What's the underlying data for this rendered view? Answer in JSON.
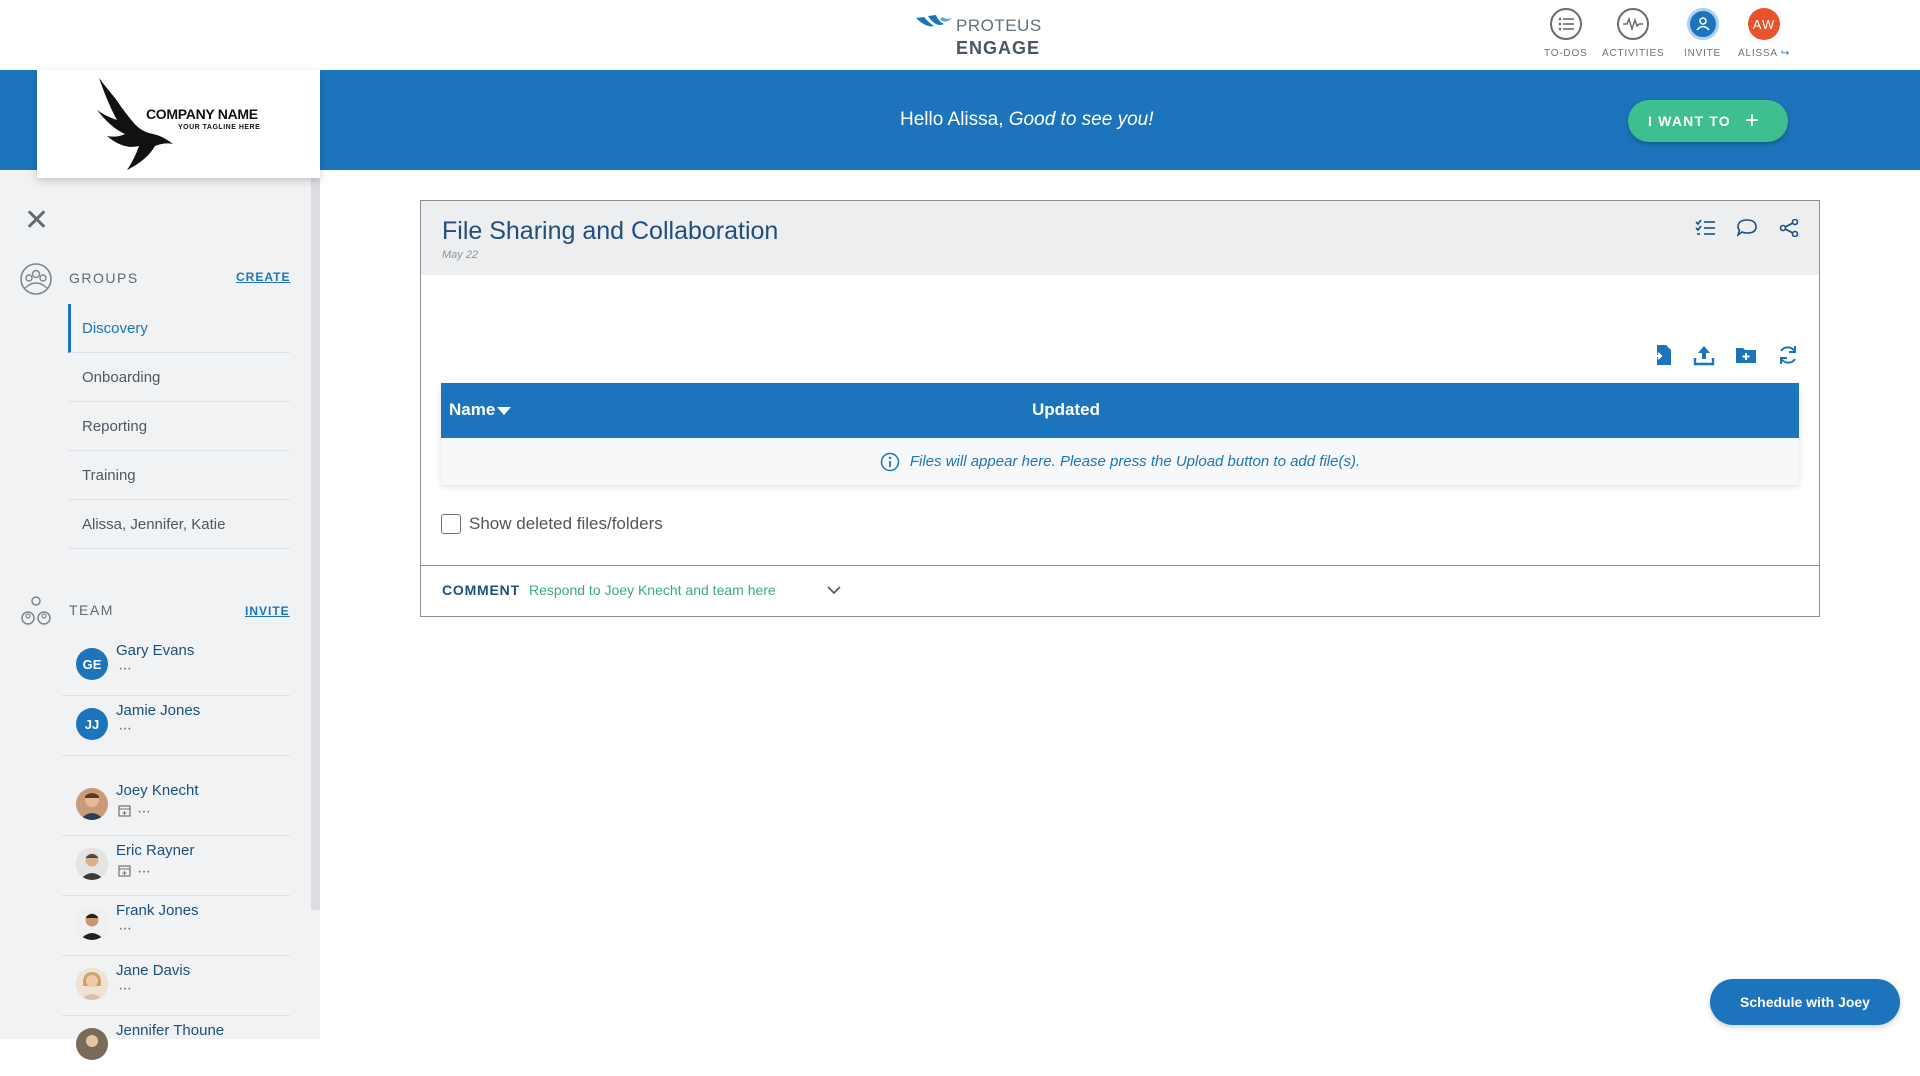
{
  "brand": {
    "line1": "PROTEUS",
    "line2": "ENGAGE"
  },
  "topnav": {
    "todos": "TO-DOS",
    "activities": "ACTIVITIES",
    "invite": "INVITE",
    "user_initials": "AW",
    "user_label": "ALISSA"
  },
  "company": {
    "name": "COMPANY NAME",
    "tagline": "YOUR TAGLINE HERE"
  },
  "banner": {
    "hello": "Hello Alissa,",
    "tagline": "Good to see you!",
    "cta": "I WANT TO"
  },
  "sidebar": {
    "groups_title": "GROUPS",
    "groups_action": "CREATE",
    "groups": [
      "Discovery",
      "Onboarding",
      "Reporting",
      "Training",
      "Alissa, Jennifer, Katie"
    ],
    "team_title": "TEAM",
    "team_action": "INVITE",
    "members": [
      {
        "name": "Gary Evans",
        "initials": "GE"
      },
      {
        "name": "Jamie Jones",
        "initials": "JJ"
      },
      {
        "name": "Joey Knecht"
      },
      {
        "name": "Eric Rayner"
      },
      {
        "name": "Frank Jones"
      },
      {
        "name": "Jane Davis"
      },
      {
        "name": "Jennifer Thoune"
      }
    ]
  },
  "card": {
    "title": "File Sharing and Collaboration",
    "date": "May 22",
    "col_name": "Name",
    "col_updated": "Updated",
    "empty_msg": "Files will appear here. Please press the Upload button to add file(s).",
    "show_deleted": "Show deleted files/folders",
    "comment_label": "COMMENT",
    "comment_prompt": "Respond to Joey Knecht and team here"
  },
  "schedule_button": "Schedule with Joey",
  "colors": {
    "primary": "#1c75bc",
    "accent_green": "#3fbf8f",
    "avatar_orange": "#e8532c"
  }
}
